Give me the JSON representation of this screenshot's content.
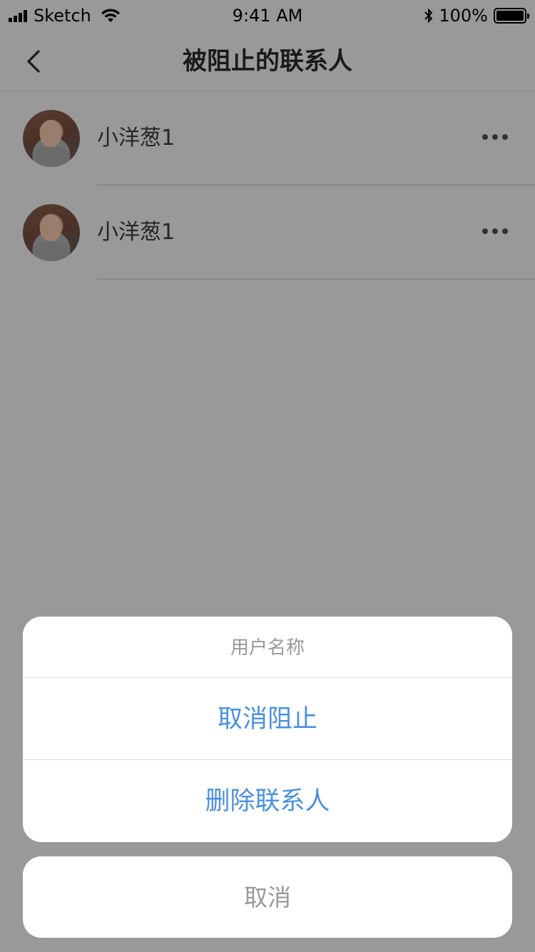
{
  "status_bar": {
    "carrier": "Sketch",
    "time": "9:41 AM",
    "battery_percent": "100%",
    "battery_level": 1.0
  },
  "nav": {
    "title": "被阻止的联系人",
    "back_icon": "chevron-left-icon"
  },
  "contacts": [
    {
      "name": "小洋葱1",
      "more_icon": "more-horizontal-icon"
    },
    {
      "name": "小洋葱1",
      "more_icon": "more-horizontal-icon"
    }
  ],
  "action_sheet": {
    "title": "用户名称",
    "actions": [
      {
        "label": "取消阻止"
      },
      {
        "label": "删除联系人"
      }
    ],
    "cancel_label": "取消"
  },
  "colors": {
    "overlay": "#999999",
    "action_blue": "#4a90e2",
    "muted_gray": "#999999"
  }
}
